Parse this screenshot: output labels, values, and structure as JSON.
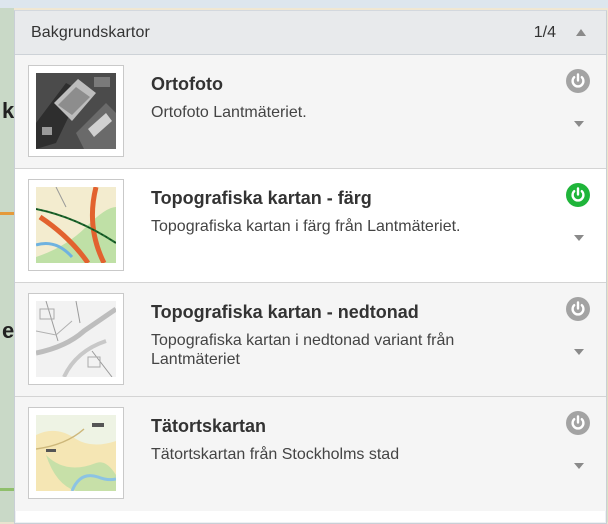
{
  "panel": {
    "title": "Bakgrundskartor",
    "count": "1/4"
  },
  "layers": [
    {
      "title": "Ortofoto",
      "description": "Ortofoto Lantmäteriet.",
      "active": false,
      "thumbnail_icon": "aerial-photo-thumbnail"
    },
    {
      "title": "Topografiska kartan - färg",
      "description": "Topografiska kartan i färg från Lantmäteriet.",
      "active": true,
      "thumbnail_icon": "topographic-color-thumbnail"
    },
    {
      "title": "Topografiska kartan - nedtonad",
      "description": "Topografiska kartan i nedtonad variant från Lantmäteriet",
      "active": false,
      "thumbnail_icon": "topographic-muted-thumbnail"
    },
    {
      "title": "Tätortskartan",
      "description": "Tätortskartan från Stockholms stad",
      "active": false,
      "thumbnail_icon": "urban-map-thumbnail"
    }
  ],
  "colors": {
    "power_active": "#1fb53a",
    "power_inactive": "#a3a3a3",
    "header_bg": "#e8eaec"
  }
}
